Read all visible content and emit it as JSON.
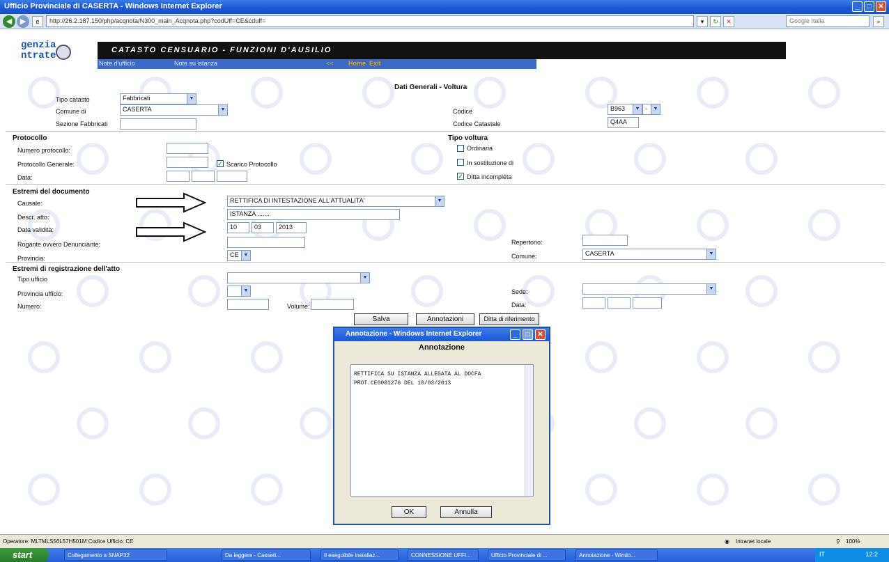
{
  "window": {
    "title": "Ufficio Provinciale di CASERTA - Windows Internet Explorer",
    "url": "http://26.2.187.150/php/acqnota/N300_main_Acqnota.php?codUff=CE&cduff=",
    "search_placeholder": "Google Italia"
  },
  "header": {
    "logo_line1": "genzia",
    "logo_line2": "ntrate",
    "title": "CATASTO CENSUARIO - FUNZIONI D'AUSILIO",
    "note_ufficio": "Note d'ufficio",
    "note_istanza": "Note su istanza",
    "nav_back": "<<",
    "home": "Home",
    "exit": "Exit"
  },
  "form": {
    "title": "Dati Generali - Voltura",
    "tipo_catasto": {
      "label": "Tipo catasto",
      "value": "Fabbricati"
    },
    "comune_di": {
      "label": "Comune di",
      "value": "CASERTA"
    },
    "sezione": {
      "label": "Sezione Fabbricati",
      "value": ""
    },
    "codice": {
      "label": "Codice",
      "value": "B963",
      "suffix": "-"
    },
    "codice_catastale": {
      "label": "Codice Catastale",
      "value": "Q4AA"
    },
    "protocollo": {
      "title": "Protocollo",
      "numero_label": "Numero protocollo:",
      "generale_label": "Protocollo Generale:",
      "scarico_label": "Scarico Protocollo",
      "data_label": "Data:"
    },
    "tipo_voltura": {
      "title": "Tipo voltura",
      "ordinaria": "Ordinaria",
      "sostituzione": "In sostituzione di",
      "ditta": "Ditta incompleta"
    },
    "estremi_doc": {
      "title": "Estremi del documento",
      "causale_label": "Causale:",
      "causale_value": "RETTIFICA DI INTESTAZIONE ALL'ATTUALITA'",
      "descr_label": "Descr. atto:",
      "descr_value": "ISTANZA .......",
      "data_label": "Data validità:",
      "day": "10",
      "month": "03",
      "year": "2013",
      "rogante_label": "Rogante ovvero Denunciante:",
      "provincia_label": "Provincia:",
      "provincia_value": "CE",
      "repertorio_label": "Repertorio:",
      "comune_label": "Comune:",
      "comune_value": "CASERTA"
    },
    "estremi_reg": {
      "title": "Estremi di registrazione dell'atto",
      "tipo_label": "Tipo ufficio",
      "prov_label": "Provincia ufficio:",
      "numero_label": "Numero:",
      "volume_label": "Volume:",
      "sede_label": "Sede:",
      "data_label": "Data:"
    },
    "buttons": {
      "salva": "Salva",
      "annotazioni": "Annotazioni",
      "ditta": "Ditta di riferimento"
    }
  },
  "modal": {
    "title": "Annotazione - Windows Internet Explorer",
    "heading": "Annotazione",
    "text": "RETTIFICA SU ISTANZA ALLEGATA AL DOCFA\nPROT.CE0001276 DEL 10/03/2013",
    "ok": "OK",
    "annulla": "Annulla"
  },
  "status": {
    "operator": "Operatore: MLTMLS56L57H501M Codice Ufficio: CE",
    "zone": "Intranet locale",
    "zoom": "100%"
  },
  "taskbar": {
    "start": "start",
    "items": [
      "Collegamento a SNAP32",
      "Da leggere - Cassett...",
      "Il eseguibile installaz...",
      "CONNESSIONE UFFI...",
      "Ufficio Provinciale di ...",
      "Annotazione - Windo..."
    ],
    "lang": "IT",
    "clock": "12:2"
  }
}
